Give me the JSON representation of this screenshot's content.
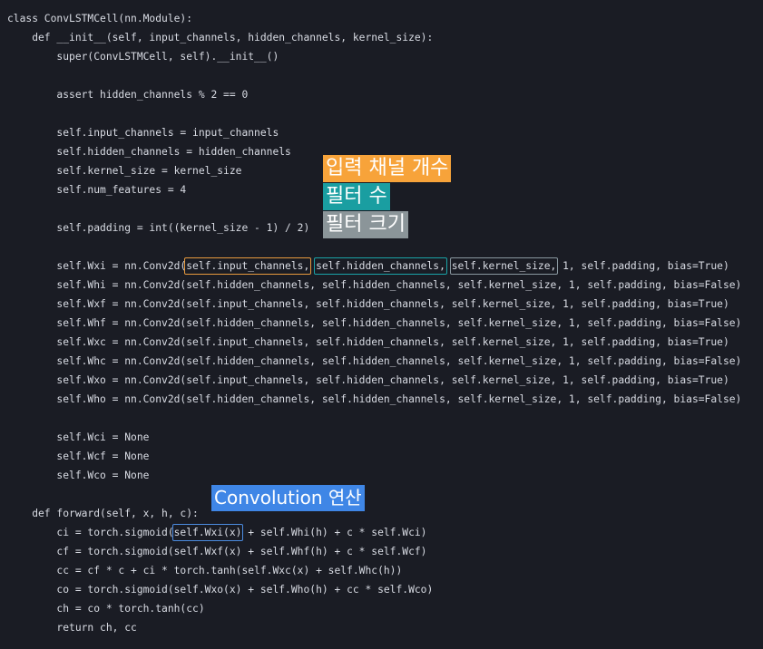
{
  "code_lines": [
    "class ConvLSTMCell(nn.Module):",
    "    def __init__(self, input_channels, hidden_channels, kernel_size):",
    "        super(ConvLSTMCell, self).__init__()",
    "",
    "        assert hidden_channels % 2 == 0",
    "",
    "        self.input_channels = input_channels",
    "        self.hidden_channels = hidden_channels",
    "        self.kernel_size = kernel_size",
    "        self.num_features = 4",
    "",
    "        self.padding = int((kernel_size - 1) / 2)",
    "",
    "        self.Wxi = nn.Conv2d(self.input_channels, self.hidden_channels, self.kernel_size, 1, self.padding, bias=True)",
    "        self.Whi = nn.Conv2d(self.hidden_channels, self.hidden_channels, self.kernel_size, 1, self.padding, bias=False)",
    "        self.Wxf = nn.Conv2d(self.input_channels, self.hidden_channels, self.kernel_size, 1, self.padding, bias=True)",
    "        self.Whf = nn.Conv2d(self.hidden_channels, self.hidden_channels, self.kernel_size, 1, self.padding, bias=False)",
    "        self.Wxc = nn.Conv2d(self.input_channels, self.hidden_channels, self.kernel_size, 1, self.padding, bias=True)",
    "        self.Whc = nn.Conv2d(self.hidden_channels, self.hidden_channels, self.kernel_size, 1, self.padding, bias=False)",
    "        self.Wxo = nn.Conv2d(self.input_channels, self.hidden_channels, self.kernel_size, 1, self.padding, bias=True)",
    "        self.Who = nn.Conv2d(self.hidden_channels, self.hidden_channels, self.kernel_size, 1, self.padding, bias=False)",
    "",
    "        self.Wci = None",
    "        self.Wcf = None",
    "        self.Wco = None",
    "",
    "    def forward(self, x, h, c):",
    "        ci = torch.sigmoid(self.Wxi(x) + self.Whi(h) + c * self.Wci)",
    "        cf = torch.sigmoid(self.Wxf(x) + self.Whf(h) + c * self.Wcf)",
    "        cc = cf * c + ci * torch.tanh(self.Wxc(x) + self.Whc(h))",
    "        co = torch.sigmoid(self.Wxo(x) + self.Who(h) + cc * self.Wco)",
    "        ch = co * torch.tanh(cc)",
    "        return ch, cc"
  ],
  "annotations": {
    "input_channels_label": "입력 채널 개수",
    "filters_label": "필터 수",
    "filter_size_label": "필터 크기",
    "convolution_label": "Convolution 연산"
  },
  "colors": {
    "background": "#1a1c24",
    "orange": "#f7a33a",
    "teal": "#1a9ea1",
    "gray": "#8b9599",
    "blue": "#3f86e6"
  }
}
